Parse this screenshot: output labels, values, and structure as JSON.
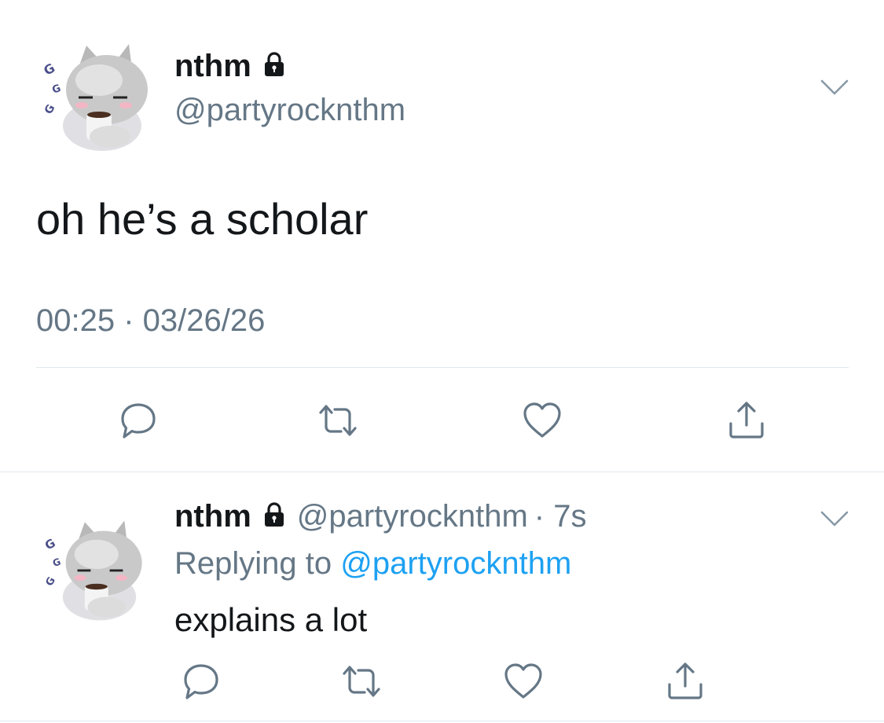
{
  "main_tweet": {
    "display_name": "nthm",
    "handle": "@partyrocknthm",
    "text": "oh he’s a scholar",
    "timestamp": "00:25 · 03/26/26"
  },
  "reply_tweet": {
    "display_name": "nthm",
    "handle": "@partyrocknthm",
    "time_ago": "· 7s",
    "replying_prefix": "Replying to",
    "replying_handle": "@partyrocknthm",
    "text": "explains a lot"
  },
  "icons": {
    "lock": "lock-icon",
    "chevron": "chevron-down-icon",
    "reply": "reply-icon",
    "retweet": "retweet-icon",
    "like": "heart-icon",
    "share": "share-icon"
  },
  "colors": {
    "text": "#14171a",
    "secondary": "#657786",
    "link": "#1da1f2",
    "divider": "#e1e8ed"
  }
}
